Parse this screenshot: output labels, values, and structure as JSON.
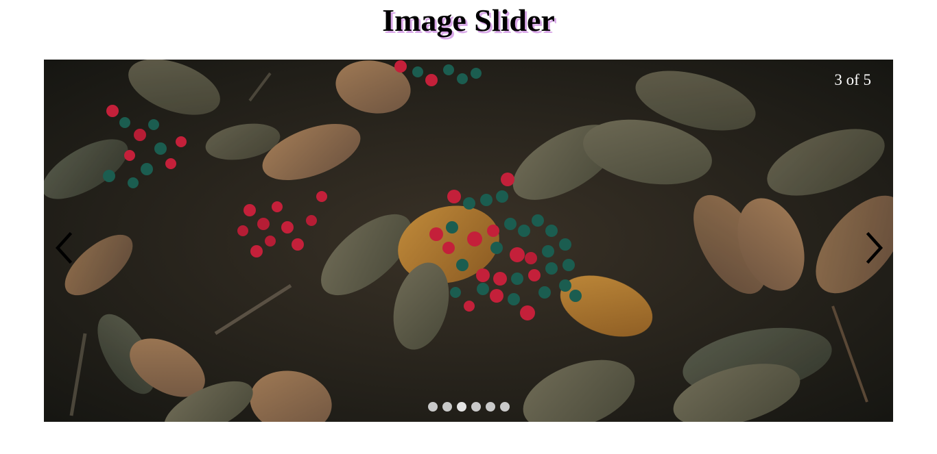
{
  "page": {
    "title": "Image Slider"
  },
  "slider": {
    "counter": "3 of 5",
    "current_index": 3,
    "total": 5,
    "prev_icon": "chevron-left-icon",
    "next_icon": "chevron-right-icon",
    "dot_count": 6,
    "image_subject": "leaves-and-berries-photo"
  },
  "colors": {
    "title_shadow": "#d8a6e8",
    "counter_text": "#ffffff",
    "dot": "#c9c9c9"
  }
}
